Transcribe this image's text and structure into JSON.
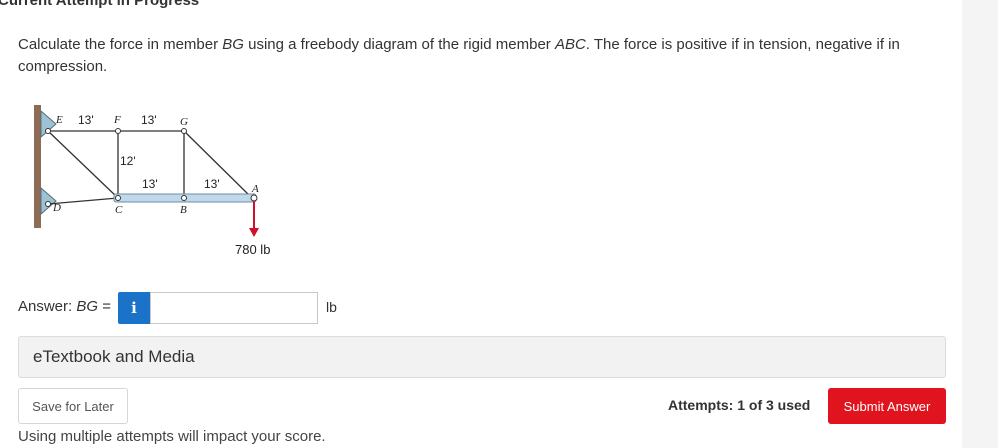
{
  "header": {
    "status": "Current Attempt in Progress"
  },
  "question": {
    "part1": "Calculate the force in member ",
    "member": "BG",
    "part2": " using a freebody diagram of the rigid member ",
    "body": "ABC",
    "part3": ". The force is positive if in tension, negative if in compression."
  },
  "figure": {
    "dims": {
      "ef": "13'",
      "fg": "13'",
      "vertical": "12'",
      "cb": "13'",
      "ba": "13'"
    },
    "points": {
      "E": "E",
      "F": "F",
      "G": "G",
      "D": "D",
      "C": "C",
      "B": "B",
      "A": "A"
    },
    "load": "780 lb"
  },
  "answer": {
    "label_prefix": "Answer: ",
    "label_member": "BG",
    "label_suffix": " =",
    "info_icon": "i",
    "value": "",
    "unit": "lb"
  },
  "etext": {
    "label": "eTextbook and Media"
  },
  "actions": {
    "save": "Save for Later",
    "attempts": "Attempts: 1 of 3 used",
    "submit": "Submit Answer"
  },
  "footer": {
    "note": "Using multiple attempts will impact your score."
  },
  "colors": {
    "submit": "#e0141e",
    "info": "#1a73c9",
    "beam": "#bfd9ea",
    "load_arrow": "#d0102a"
  }
}
